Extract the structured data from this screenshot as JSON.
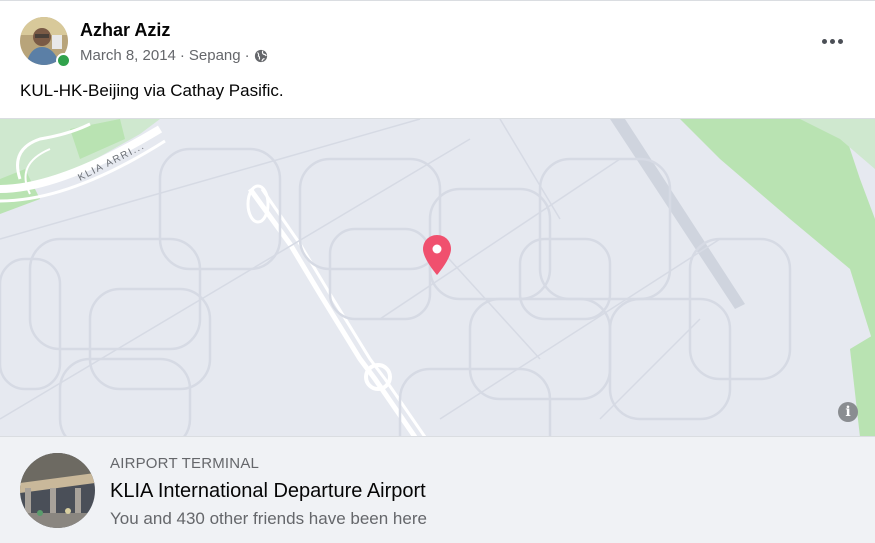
{
  "post": {
    "author": "Azhar Aziz",
    "date": "March 8, 2014",
    "location": "Sepang",
    "separator": "·",
    "privacy_icon": "globe-icon",
    "more_icon": "more-options-icon",
    "text": "KUL-HK-Beijing via Cathay Pasific."
  },
  "map": {
    "road_label": "KLIA ARRI...",
    "pin_color": "#f0506e",
    "info_label": "i",
    "park_color": "#b9e3b2",
    "background_color": "#e6e9f0"
  },
  "place": {
    "category": "AIRPORT TERMINAL",
    "name": "KLIA International Departure Airport",
    "friends": "You and 430 other friends have been here"
  }
}
